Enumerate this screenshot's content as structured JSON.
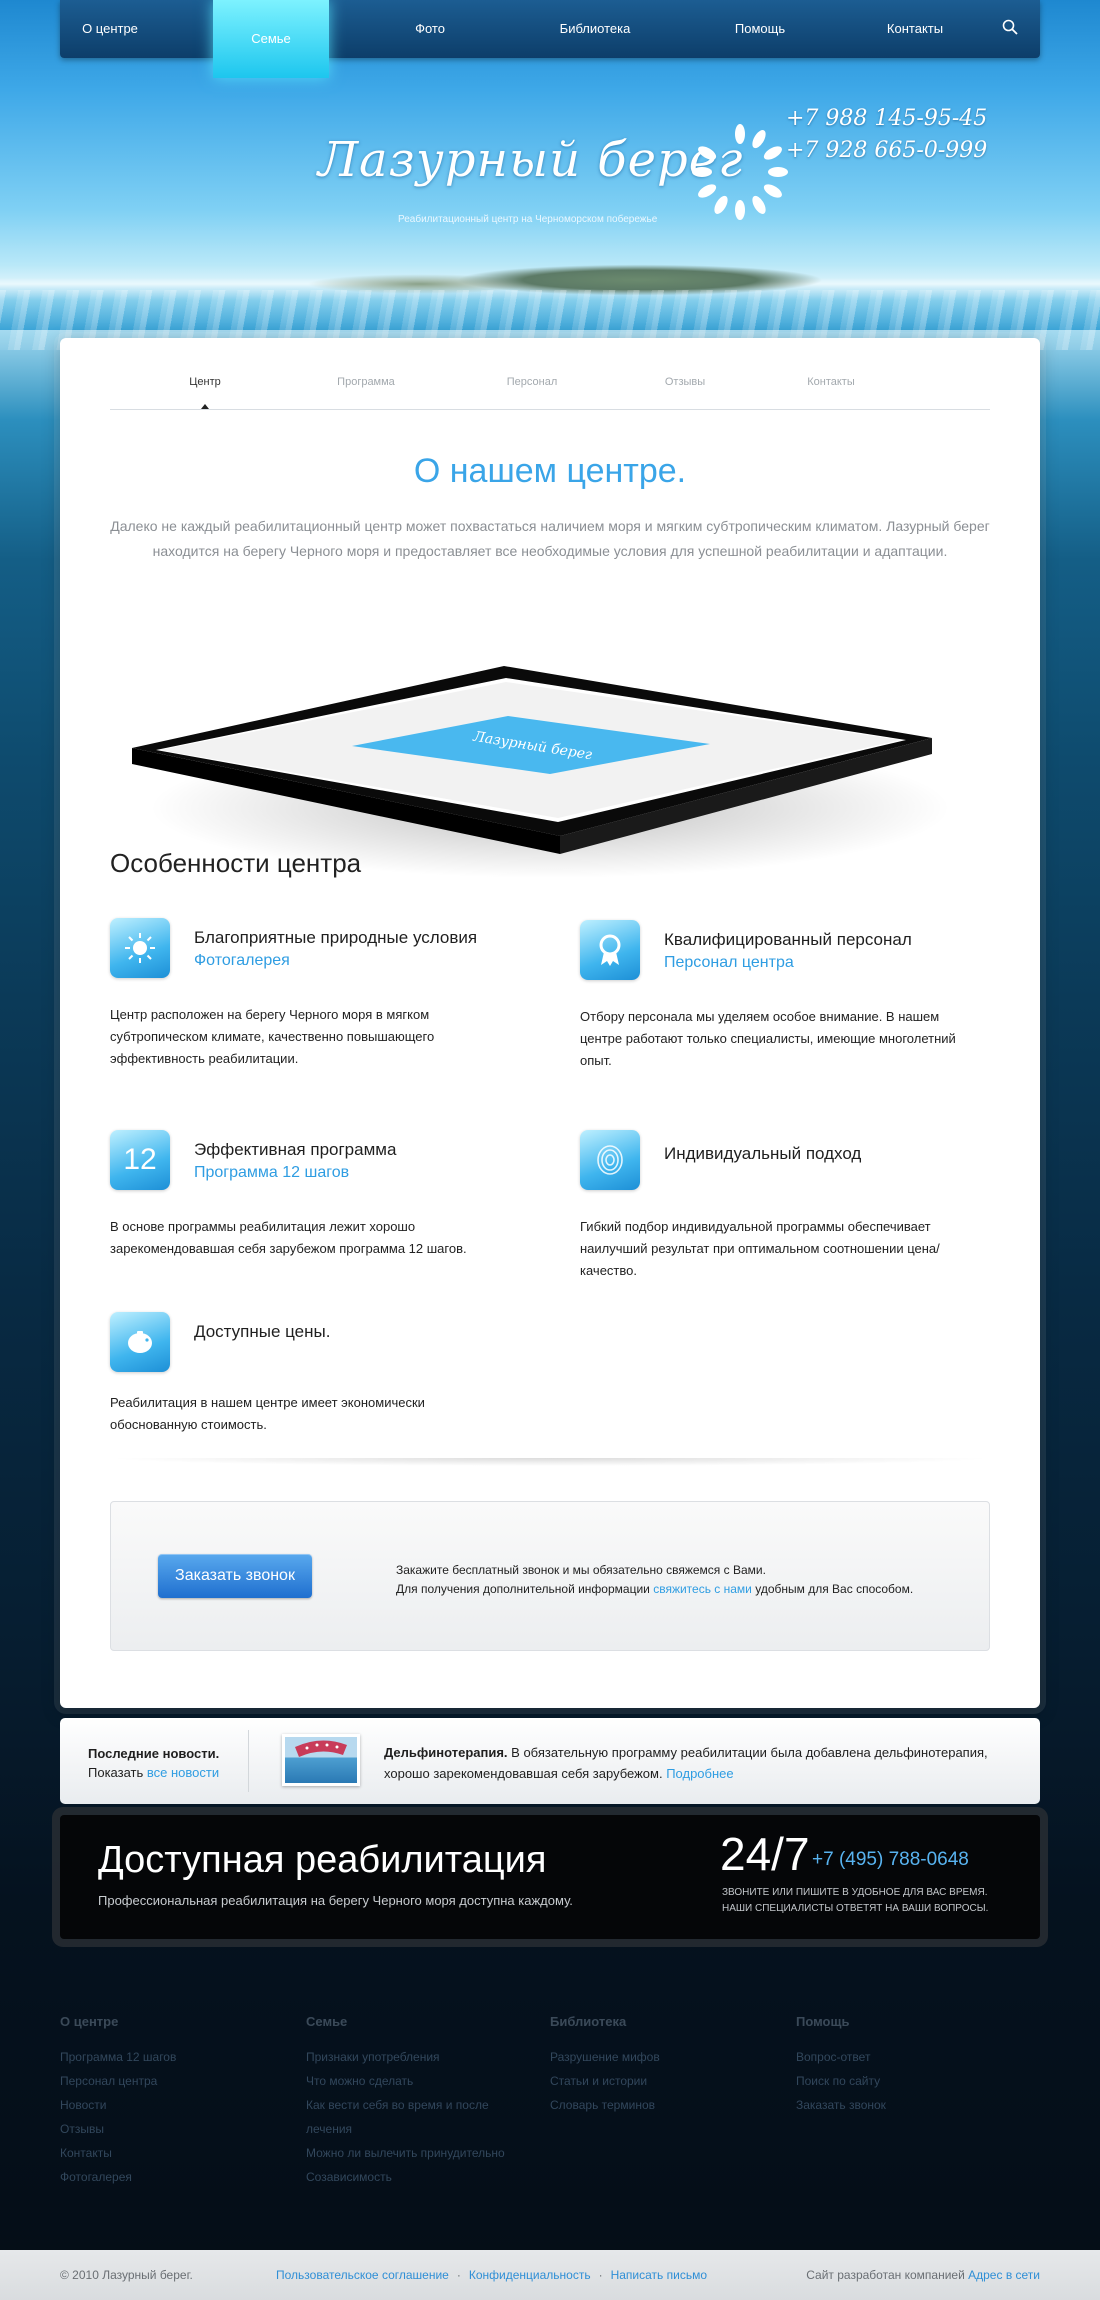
{
  "nav": {
    "items": [
      "О центре",
      "Семье",
      "Фото",
      "Библиотека",
      "Помощь",
      "Контакты"
    ],
    "active_index": 1,
    "search_icon": "search-icon"
  },
  "header": {
    "logo_text": "Лазурный берег",
    "tagline": "Реабилитационный центр на Черноморском побережье",
    "phones": [
      "+7 988 145-95-45",
      "+7 928 665-0-999"
    ]
  },
  "tabs": {
    "items": [
      "Центр",
      "Программа",
      "Персонал",
      "Отзывы",
      "Контакты"
    ],
    "active_index": 0
  },
  "about": {
    "title": "О нашем центре.",
    "lead": "Далеко не каждый реабилитационный центр может похвастаться наличием моря и мягким субтропическим климатом. Лазурный берег находится на берегу Черного моря и предоставляет все необходимые условия для успешной реабилитации и адаптации.",
    "frame_screen_text": "Лазурный берег"
  },
  "features": {
    "title": "Особенности центра",
    "items": [
      {
        "title": "Благоприятные природные условия",
        "link": "Фотогалерея",
        "text": "Центр расположен на берегу Черного моря в мягком субтропическом климате, качественно повышающего эффективность реабилитации.",
        "icon": "sun-icon"
      },
      {
        "title": "Квалифицированный персонал",
        "link": "Персонал центра",
        "text": "Отбору персонала мы уделяем особое внимание. В нашем центре работают только специалисты, имеющие многолетний опыт.",
        "icon": "award-icon"
      },
      {
        "title": "Эффективная программа",
        "link": "Программа 12 шагов",
        "text": "В основе программы реабилитация лежит хорошо зарекомендовавшая себя зарубежом программа 12 шагов.",
        "icon": "number-12-icon",
        "icon_text": "12"
      },
      {
        "title": "Индивидуальный подход",
        "link": "",
        "text": "Гибкий подбор индивидуальной программы обеспечивает наилучший результат при оптимальном соотношении цена/качество.",
        "icon": "fingerprint-icon"
      },
      {
        "title": "Доступные цены.",
        "link": "",
        "text": "Реабилитация в нашем центре имеет экономически обоснованную стоимость.",
        "icon": "piggy-bank-icon"
      }
    ]
  },
  "callback": {
    "button": "Заказать звонок",
    "line1": "Закажите бесплатный звонок и мы обязательно свяжемся с Вами.",
    "line2_before": "Для получения дополнительной информации",
    "line2_link": "свяжитесь с нами",
    "line2_after": "удобным для Вас способом."
  },
  "news": {
    "heading": "Последние новости.",
    "show_prefix": "Показать",
    "show_link": "все новости",
    "item_title": "Дельфинотерапия.",
    "item_text": "В обязательную программу реабилитации была добавлена дельфинотерапия, хорошо зарекомендовавшая себя зарубежом.",
    "item_more": "Подробнее"
  },
  "promo": {
    "title": "Доступная реабилитация",
    "subtitle": "Профессиональная реабилитация на берегу Черного моря доступна каждому.",
    "big": "24/7",
    "phone": "+7 (495) 788-0648",
    "note1": "Звоните или пишите в удобное для вас время.",
    "note2": "Наши специалисты ответят на ваши вопросы."
  },
  "footer": {
    "columns": [
      {
        "title": "О центре",
        "links": [
          "Программа 12 шагов",
          "Персонал центра",
          "Новости",
          "Отзывы",
          "Контакты",
          "Фотогалерея"
        ]
      },
      {
        "title": "Семье",
        "links": [
          "Признаки употребления",
          "Что можно сделать",
          "Как вести себя во время и после",
          "лечения",
          "Можно ли вылечить принудительно",
          "Созависимость"
        ]
      },
      {
        "title": "Библиотека",
        "links": [
          "Разрушение мифов",
          "Статьи и истории",
          "Словарь терминов"
        ]
      },
      {
        "title": "Помощь",
        "links": [
          "Вопрос-ответ",
          "Поиск по сайту",
          "Заказать звонок"
        ]
      }
    ],
    "copyright": "© 2010 Лазурный берег.",
    "links": [
      "Пользовательское соглашение",
      "Конфиденциальность",
      "Написать письмо"
    ],
    "credit_prefix": "Сайт разработан компанией",
    "credit_link": "Адрес в сети"
  },
  "colors": {
    "accent": "#3aa5e8",
    "nav_active": "#1dc6ee",
    "promo_bg": "#050608"
  }
}
